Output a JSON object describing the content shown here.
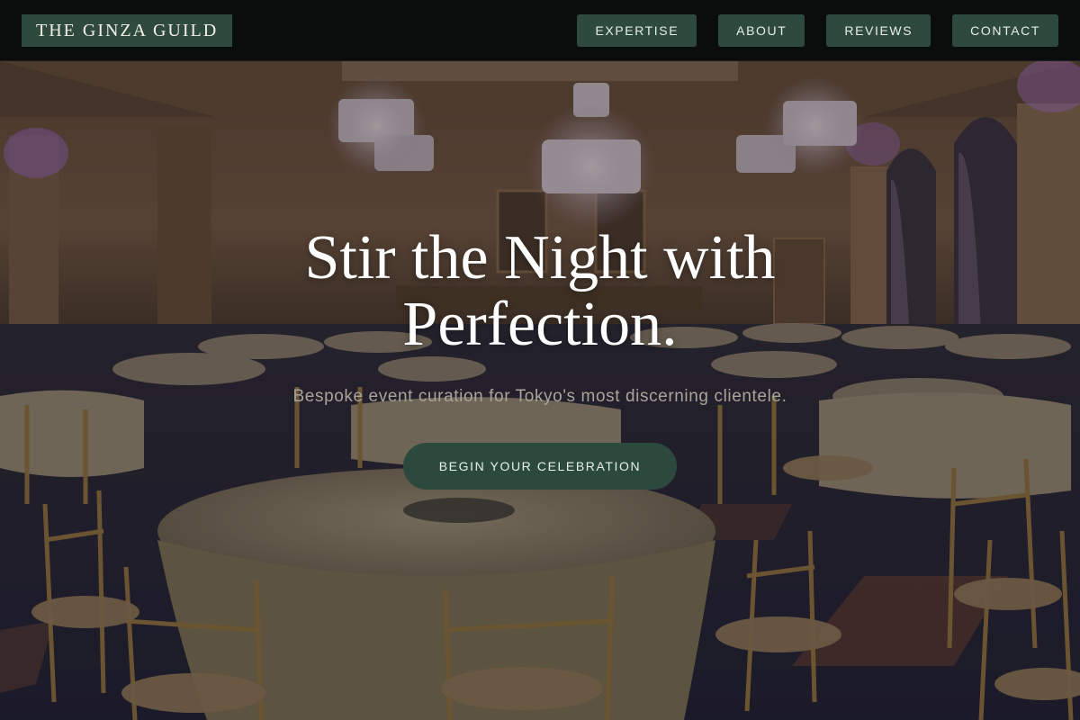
{
  "brand": {
    "name": "THE GINZA GUILD"
  },
  "nav": {
    "items": [
      {
        "label": "EXPERTISE"
      },
      {
        "label": "ABOUT"
      },
      {
        "label": "REVIEWS"
      },
      {
        "label": "CONTACT"
      }
    ]
  },
  "hero": {
    "title": "Stir the Night with Perfection.",
    "subtitle": "Bespoke event curation for Tokyo's most discerning clientele.",
    "cta_label": "BEGIN YOUR CELEBRATION",
    "background_image": "ballroom-banquet-photo"
  },
  "colors": {
    "accent": "#2e4a3e",
    "nav_bg": "#0a0e0c",
    "title_text": "#ffffff",
    "subtitle_text": "#a9a49b"
  }
}
